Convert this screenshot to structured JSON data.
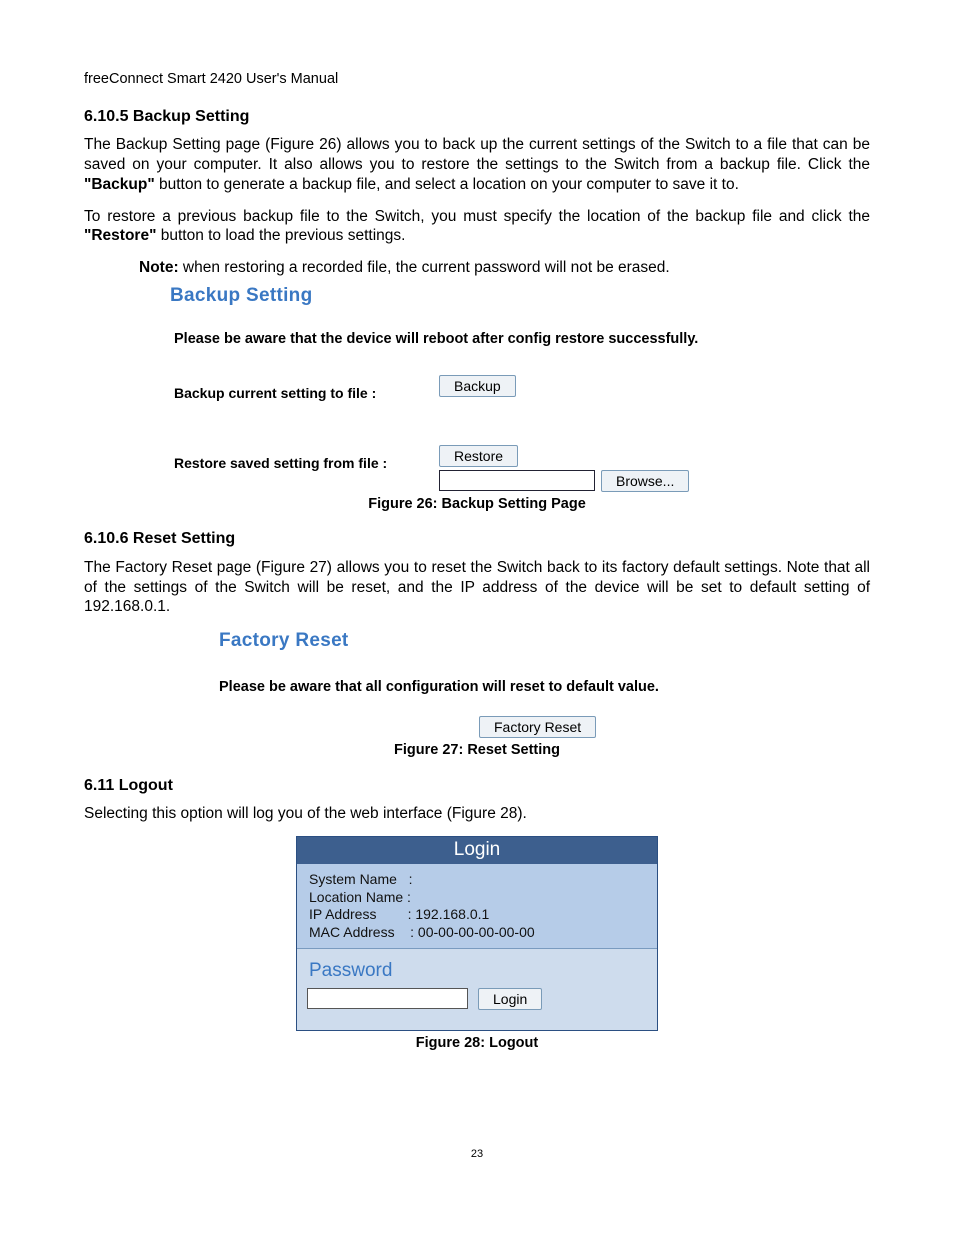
{
  "header": "freeConnect Smart 2420 User's Manual",
  "sections": {
    "backup": {
      "heading": "6.10.5 Backup Setting",
      "p1a": "The Backup Setting page (Figure 26) allows you to back up the current settings of the Switch to a file that can be saved on your computer.  It also allows you to restore the settings to the Switch from a backup file.   Click the ",
      "p1b": "\"Backup\"",
      "p1c": " button to generate a backup file, and select a location on your computer to save it to.",
      "p2a": "To restore a previous backup file to the Switch, you must specify the location of the backup file and click the ",
      "p2b": "\"Restore\"",
      "p2c": " button to load the previous settings.",
      "note_label": "Note:",
      "note_text": " when restoring a recorded file, the current password will not be erased."
    },
    "reset": {
      "heading": "6.10.6 Reset Setting",
      "p1": "The Factory Reset page (Figure 27) allows you to reset the Switch back to its factory default settings. Note that all of the settings of the Switch will be reset, and the IP address of the device will be set to default setting of 192.168.0.1."
    },
    "logout": {
      "heading": "6.11  Logout",
      "p1": "Selecting this option will log you of the web interface (Figure 28)."
    }
  },
  "fig26": {
    "title": "Backup Setting",
    "warn": "Please be aware that the device will reboot after config restore successfully.",
    "backup_label": "Backup current setting to file :",
    "backup_btn": "Backup",
    "restore_label": "Restore saved setting from file :",
    "restore_btn": "Restore",
    "browse_btn": "Browse...",
    "caption": "Figure 26: Backup Setting Page"
  },
  "fig27": {
    "title": "Factory Reset",
    "warn": "Please be aware that all configuration will reset to default value.",
    "btn": "Factory Reset",
    "caption": "Figure 27: Reset Setting"
  },
  "fig28": {
    "header": "Login",
    "rows": {
      "sys": "System Name   :",
      "loc": "Location Name :",
      "ip": "IP Address        : 192.168.0.1",
      "mac": "MAC Address    : 00-00-00-00-00-00"
    },
    "pw_label": "Password",
    "login_btn": "Login",
    "caption": "Figure 28: Logout"
  },
  "page_number": "23"
}
